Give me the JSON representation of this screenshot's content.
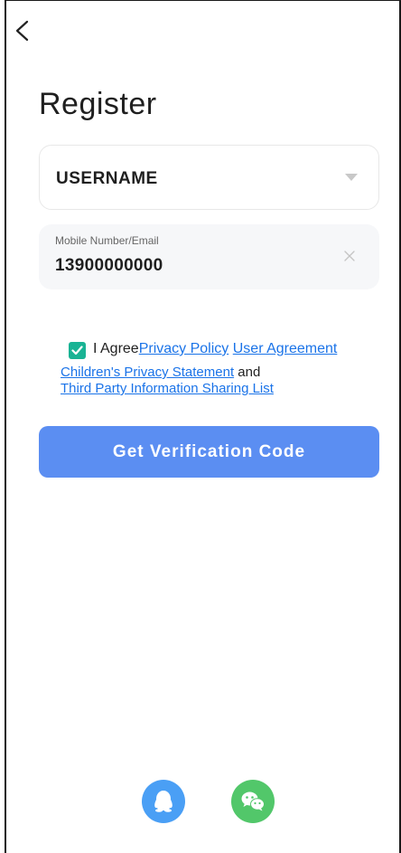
{
  "header": {
    "back_icon": "chevron-left-icon",
    "title": "Register"
  },
  "form": {
    "username": {
      "value": "USERNAME",
      "icon": "caret-down-icon"
    },
    "contact": {
      "label": "Mobile Number/Email",
      "value": "13900000000",
      "clear_icon": "close-icon"
    }
  },
  "agreement": {
    "checked": true,
    "prefix": "I Agree",
    "privacy_policy": "Privacy Policy",
    "user_agreement": "User Agreement",
    "children_privacy": "Children's Privacy Statement",
    "and_text": "and",
    "third_party": "Third Party Information Sharing List"
  },
  "actions": {
    "verify_label": "Get Verification Code"
  },
  "social": {
    "qq_icon": "qq-icon",
    "wechat_icon": "wechat-icon"
  },
  "colors": {
    "primary_button": "#5b8ef2",
    "checkbox": "#19b394",
    "link": "#1a73e8",
    "qq": "#4a9ff5",
    "wechat": "#52c76a"
  }
}
